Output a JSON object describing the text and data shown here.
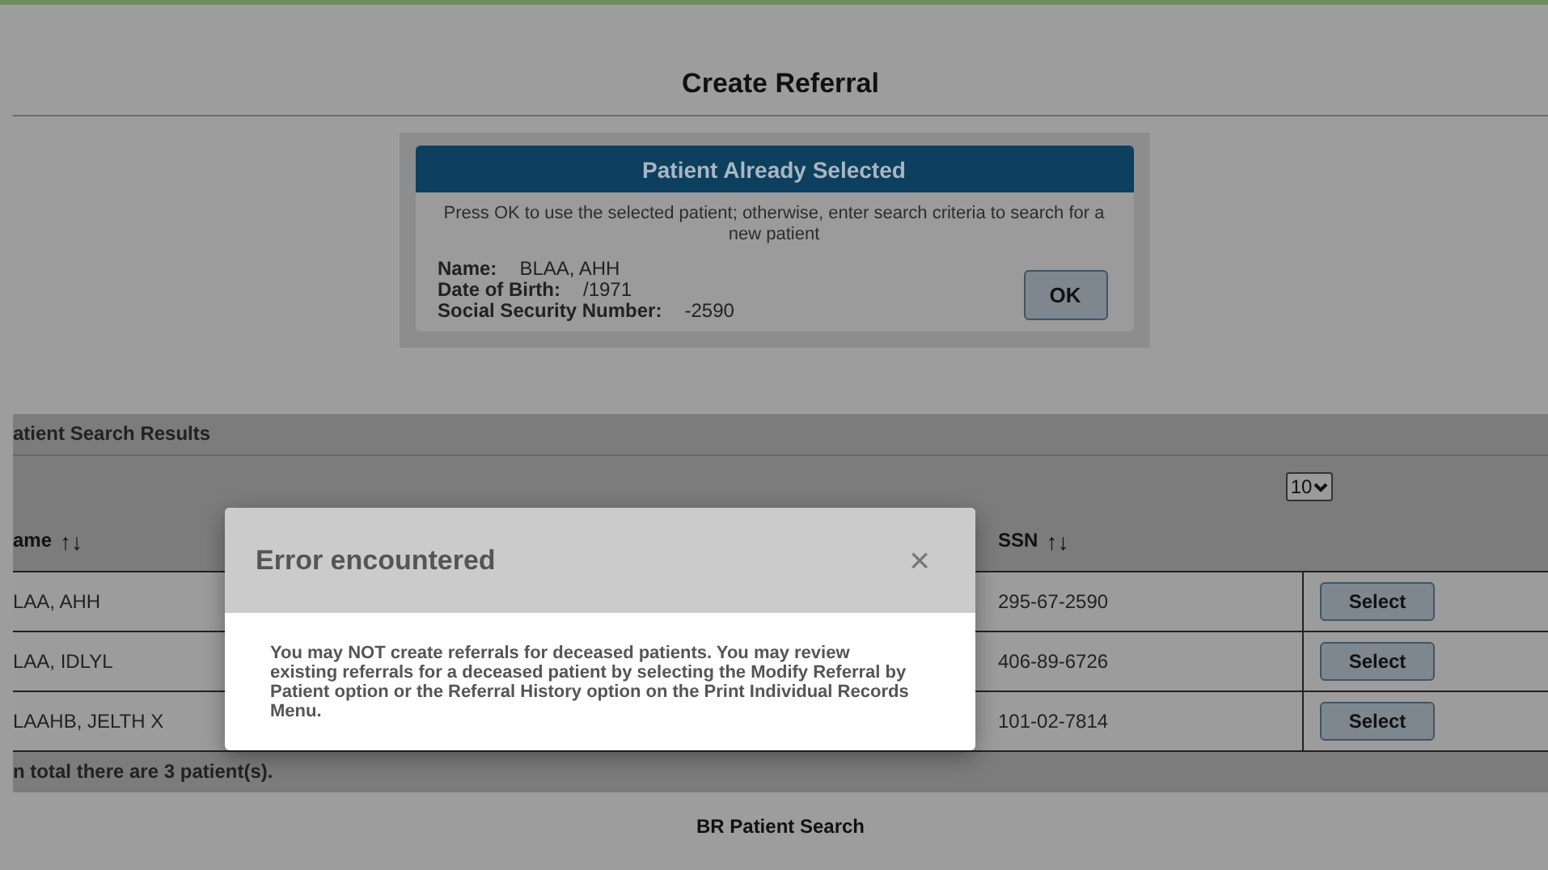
{
  "page": {
    "title": "Create Referral"
  },
  "patient_card": {
    "title": "Patient Already Selected",
    "message": "Press OK to use the selected patient; otherwise, enter search criteria to search for a new patient",
    "fields": [
      {
        "label": "Name:",
        "value": "BLAA, AHH"
      },
      {
        "label": "Date of Birth:",
        "value": "/1971"
      },
      {
        "label": "Social Security Number:",
        "value": "-2590"
      }
    ],
    "button": "OK"
  },
  "results": {
    "title": "atient Search Results",
    "pager": {
      "page_size": "10"
    },
    "columns": [
      {
        "label": "ame",
        "sort_icon": "↑↓"
      },
      {
        "label": "SSN",
        "sort_icon": "↑↓"
      }
    ],
    "rows": [
      {
        "name": "LAA, AHH",
        "ssn": "295-67-2590",
        "action": "Select"
      },
      {
        "name": "LAA, IDLYL",
        "ssn": "406-89-6726",
        "action": "Select"
      },
      {
        "name": "LAAHB, JELTH X",
        "ssn": "101-02-7814",
        "action": "Select"
      }
    ],
    "total": "n total there are 3 patient(s)."
  },
  "search_section": {
    "title": "BR Patient Search"
  },
  "dialog": {
    "title": "Error encountered",
    "close": "×",
    "message": "You may NOT create referrals for deceased patients. You may review existing referrals for a deceased patient by selecting the Modify Referral by Patient option or the Referral History option on the Print Individual Records Menu."
  }
}
